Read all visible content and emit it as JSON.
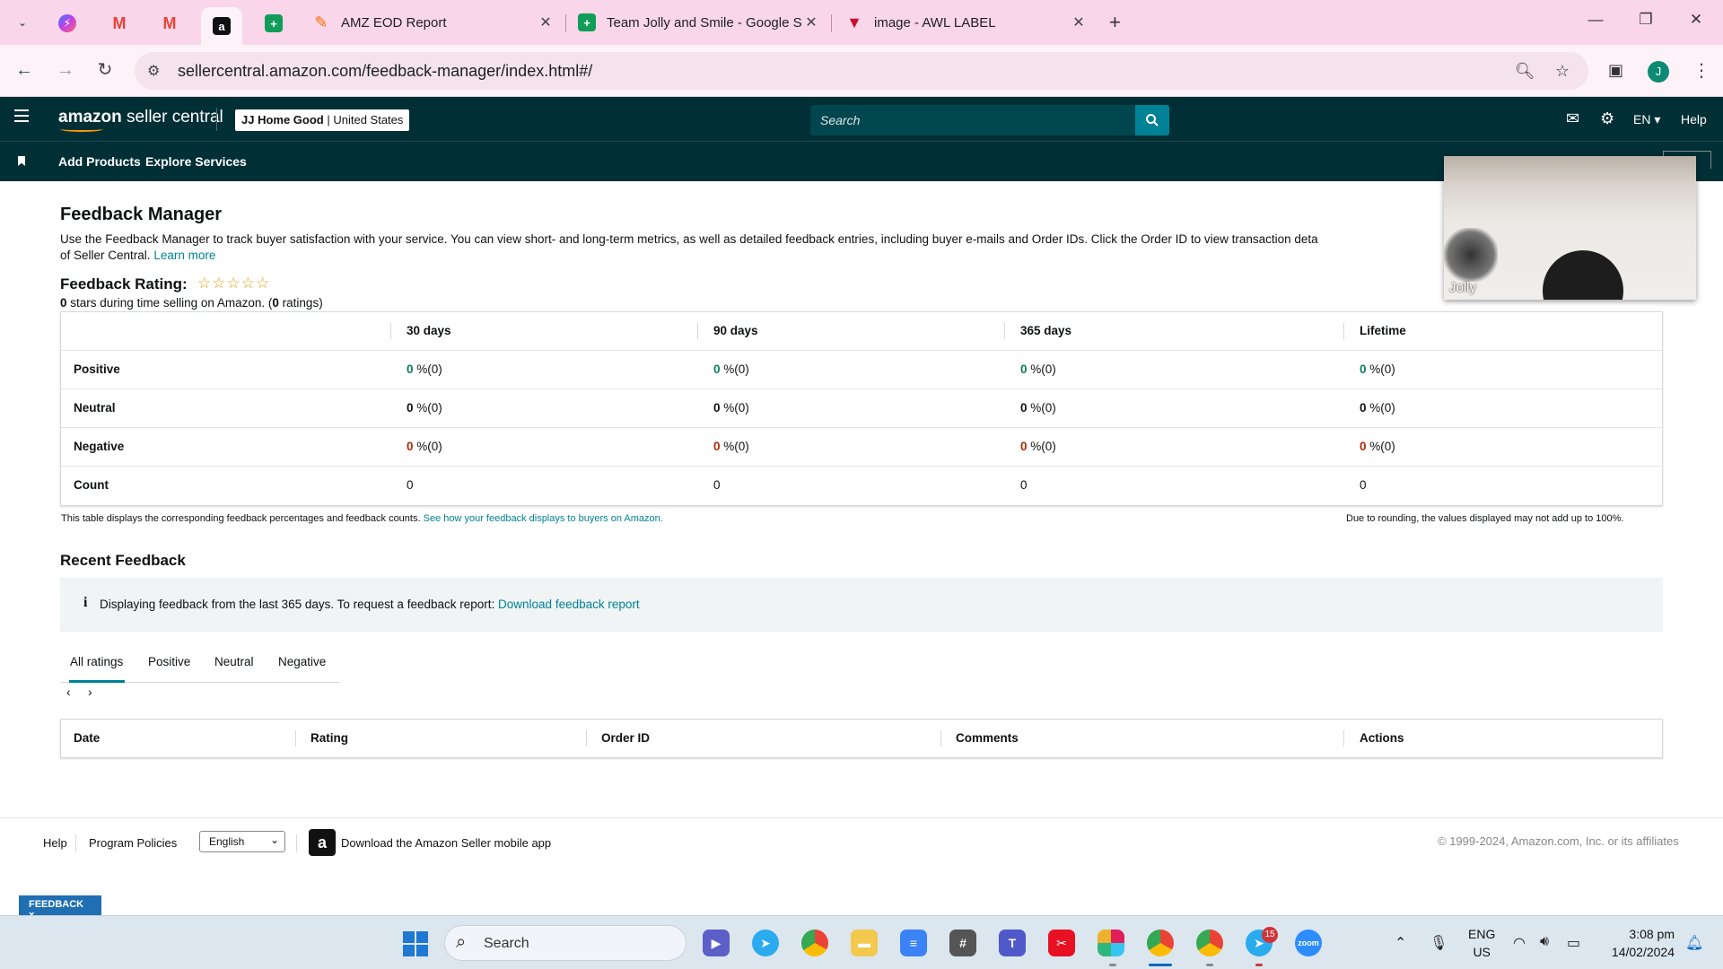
{
  "browser": {
    "tabs": [
      {
        "title": "AMZ EOD Report",
        "icon": "zapier-icon"
      },
      {
        "title": "Team Jolly and Smile - Google S",
        "icon": "sheets-icon"
      },
      {
        "title": "image - AWL LABEL",
        "icon": "awl-icon"
      }
    ],
    "pinned": [
      "messenger-icon",
      "gmail-icon",
      "gmail-icon",
      "amazon-icon",
      "sheets-icon"
    ],
    "url": "sellercentral.amazon.com/feedback-manager/index.html#/",
    "profile_initial": "J"
  },
  "header": {
    "logo_amazon": "amazon",
    "logo_rest": "seller central",
    "store_name": "JJ Home Good",
    "store_region": "United States",
    "search_placeholder": "Search",
    "lang": "EN",
    "help": "Help"
  },
  "nav": {
    "add_products": "Add Products",
    "explore_services": "Explore Services"
  },
  "video": {
    "participant": "Jolly"
  },
  "page": {
    "title": "Feedback Manager",
    "description": "Use the Feedback Manager to track buyer satisfaction with your service. You can view short- and long-term metrics, as well as detailed feedback entries, including buyer e-mails and Order IDs. Click the Order ID to view transaction deta",
    "description_tail": "of Seller Central.",
    "learn_more": "Learn more"
  },
  "rating": {
    "label": "Feedback Rating:",
    "stars": 0,
    "stars_value": "0",
    "stars_text": "stars during time selling on Amazon. (",
    "ratings_count": "0",
    "ratings_text": "ratings)"
  },
  "feedback_table": {
    "columns": [
      "30 days",
      "90 days",
      "365 days",
      "Lifetime"
    ],
    "rows": [
      {
        "label": "Positive",
        "values": [
          "0",
          "0",
          "0",
          "0"
        ],
        "suffix": "%(0)"
      },
      {
        "label": "Neutral",
        "values": [
          "0",
          "0",
          "0",
          "0"
        ],
        "suffix": "%(0)"
      },
      {
        "label": "Negative",
        "values": [
          "0",
          "0",
          "0",
          "0"
        ],
        "suffix": "%(0)"
      },
      {
        "label": "Count",
        "values": [
          "0",
          "0",
          "0",
          "0"
        ]
      }
    ],
    "note": "This table displays the corresponding feedback percentages and feedback counts.",
    "note_link": "See how your feedback displays to buyers on Amazon.",
    "rounding_note": "Due to rounding, the values displayed may not add up to 100%."
  },
  "recent": {
    "title": "Recent Feedback",
    "info": "Displaying feedback from the last 365 days. To request a feedback report:",
    "info_link": "Download feedback report",
    "tabs": [
      "All ratings",
      "Positive",
      "Neutral",
      "Negative"
    ],
    "active_tab": "All ratings",
    "columns": [
      "Date",
      "Rating",
      "Order ID",
      "Comments",
      "Actions"
    ]
  },
  "footer": {
    "help": "Help",
    "policies": "Program Policies",
    "language": "English",
    "app": "Download the Amazon Seller mobile app",
    "copyright": "© 1999-2024, Amazon.com, Inc. or its affiliates",
    "feedback_tab": "FEEDBACK ×"
  },
  "taskbar": {
    "search": "Search",
    "lang_line1": "ENG",
    "lang_line2": "US",
    "time": "3:08 pm",
    "date": "14/02/2024",
    "telegram_badge": "15"
  }
}
